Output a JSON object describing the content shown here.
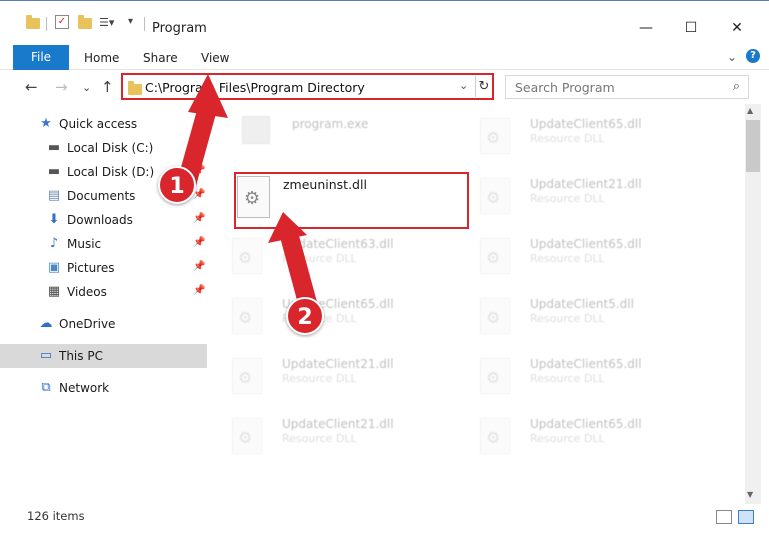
{
  "window": {
    "title": "Program",
    "minimize": "—",
    "maximize": "☐",
    "close": "✕"
  },
  "ribbon": {
    "file": "File",
    "tabs": [
      "Home",
      "Share",
      "View"
    ],
    "collapse": "⌄",
    "help": "?"
  },
  "nav": {
    "back": "←",
    "forward": "→",
    "recent": "⌄",
    "up": "↑",
    "address": "C:\\Program Files\\Program Directory",
    "address_dropdown": "⌄",
    "refresh": "↻",
    "search_placeholder": "Search Program",
    "search_icon": "⌕"
  },
  "sidebar": {
    "items": [
      {
        "label": "Quick access",
        "icon": "star-icon",
        "glyph": "★",
        "color": "#3a78c9"
      },
      {
        "label": "Local Disk (C:)",
        "icon": "drive-icon",
        "glyph": "▬",
        "color": "#555555"
      },
      {
        "label": "Local Disk (D:)",
        "icon": "drive-icon",
        "glyph": "▬",
        "color": "#555555"
      },
      {
        "label": "Documents",
        "icon": "documents-icon",
        "glyph": "▤",
        "color": "#6b87b3"
      },
      {
        "label": "Downloads",
        "icon": "download-icon",
        "glyph": "⬇",
        "color": "#2f6fc7"
      },
      {
        "label": "Music",
        "icon": "music-icon",
        "glyph": "♪",
        "color": "#2f6fc7"
      },
      {
        "label": "Pictures",
        "icon": "pictures-icon",
        "glyph": "▣",
        "color": "#4a88c9"
      },
      {
        "label": "Videos",
        "icon": "videos-icon",
        "glyph": "▦",
        "color": "#444444"
      },
      {
        "label": "OneDrive",
        "icon": "cloud-icon",
        "glyph": "☁",
        "color": "#2f6fc7"
      },
      {
        "label": "This PC",
        "icon": "computer-icon",
        "glyph": "▭",
        "color": "#2f6fc7"
      },
      {
        "label": "Network",
        "icon": "network-icon",
        "glyph": "⧉",
        "color": "#2f6fc7"
      }
    ],
    "pin": "📌"
  },
  "files": {
    "exe": {
      "name": "program.exe"
    },
    "focused": {
      "name": "zmeuninst.dll"
    },
    "dll_type": "Resource DLL",
    "left_column": [
      "UpdateClient63.dll",
      "UpdateClient65.dll",
      "UpdateClient21.dll",
      "UpdateClient21.dll"
    ],
    "right_column": [
      "UpdateClient65.dll",
      "UpdateClient21.dll",
      "UpdateClient65.dll",
      "UpdateClient5.dll",
      "UpdateClient65.dll",
      "UpdateClient65.dll"
    ]
  },
  "status": {
    "item_count": "126 items"
  },
  "annotations": {
    "marker_1": "1",
    "marker_2": "2",
    "accent_color": "#d9262c"
  }
}
